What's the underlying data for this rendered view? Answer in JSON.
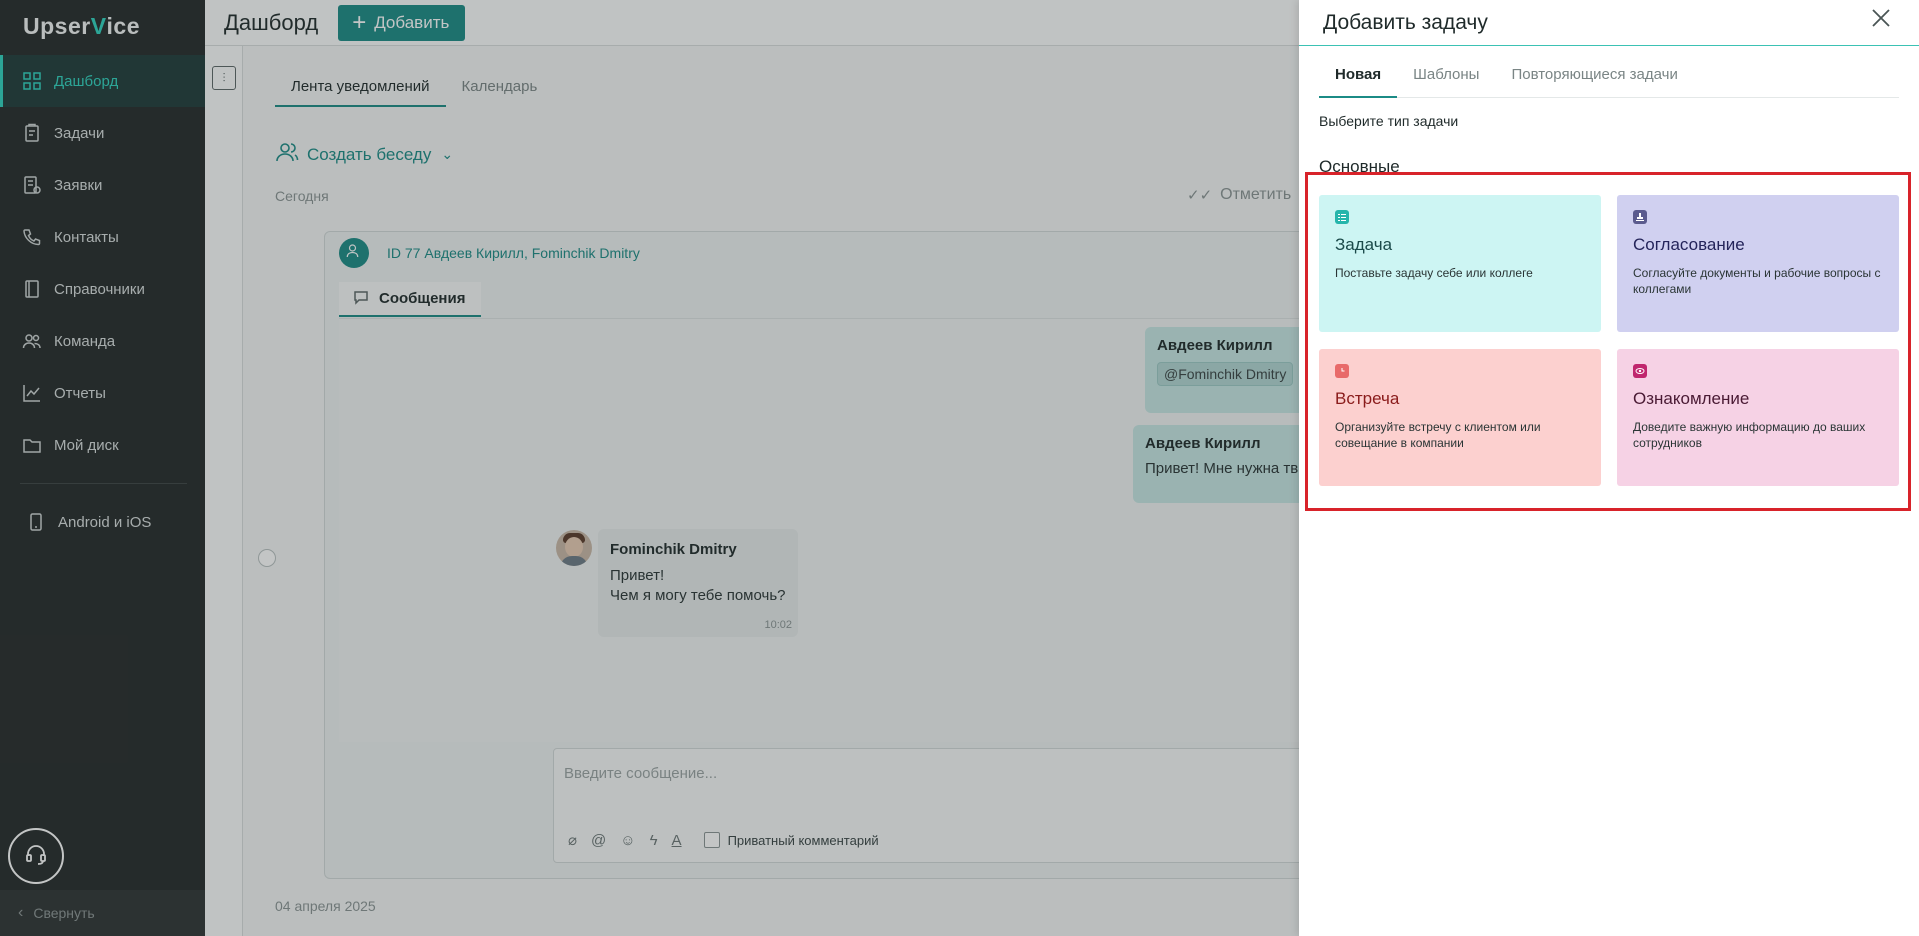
{
  "sidebar": {
    "logo": {
      "part1": "Upser",
      "part2": "V",
      "part3": "ice"
    },
    "items": [
      {
        "label": "Дашборд",
        "icon": "dashboard-icon",
        "active": true
      },
      {
        "label": "Задачи",
        "icon": "tasks-icon"
      },
      {
        "label": "Заявки",
        "icon": "requests-icon"
      },
      {
        "label": "Контакты",
        "icon": "phone-icon"
      },
      {
        "label": "Справочники",
        "icon": "book-icon"
      },
      {
        "label": "Команда",
        "icon": "team-icon"
      },
      {
        "label": "Отчеты",
        "icon": "chart-icon"
      },
      {
        "label": "Мой диск",
        "icon": "folder-icon"
      }
    ],
    "mobile": {
      "label": "Android и iOS",
      "icon": "phone-device-icon"
    },
    "collapse_label": "Свернуть"
  },
  "header": {
    "title": "Дашборд",
    "add_label": "Добавить"
  },
  "feed": {
    "tabs": [
      {
        "label": "Лента уведомлений",
        "active": true
      },
      {
        "label": "Календарь"
      }
    ],
    "create_chat_label": "Создать беседу",
    "today_label": "Сегодня",
    "mark_label": "Отметить",
    "chat": {
      "title": "ID 77 Авдеев Кирилл, Fominchik Dmitry",
      "messages_tab": "Сообщения",
      "out1": {
        "name": "Авдеев Кирилл",
        "mention": "@Fominchik Dmitry"
      },
      "out2": {
        "name": "Авдеев Кирилл",
        "text": "Привет! Мне нужна тв"
      },
      "in": {
        "name": "Fominchik Dmitry",
        "line1": "Привет!",
        "line2": "Чем я могу тебе помочь?",
        "time": "10:02"
      },
      "composer_placeholder": "Введите сообщение...",
      "private_label": "Приватный комментарий"
    },
    "date_separator": "04 апреля 2025"
  },
  "panel": {
    "title": "Добавить задачу",
    "tabs": [
      {
        "label": "Новая",
        "active": true
      },
      {
        "label": "Шаблоны"
      },
      {
        "label": "Повторяющиеся задачи"
      }
    ],
    "choose_label": "Выберите тип задачи",
    "section_label": "Основные",
    "cards": {
      "task": {
        "title": "Задача",
        "desc": "Поставьте задачу себе или коллеге",
        "color": "#cdf5f3"
      },
      "approval": {
        "title": "Согласование",
        "desc": "Согласуйте документы и рабочие вопросы с коллегами",
        "color": "#d0d0f0"
      },
      "meeting": {
        "title": "Встреча",
        "desc": "Организуйте встречу с клиентом или совещание в компании",
        "color": "#fcd0cf"
      },
      "ack": {
        "title": "Ознакомление",
        "desc": "Доведите важную информацию до ваших сотрудников",
        "color": "#f6d2e5"
      }
    }
  },
  "colors": {
    "accent": "#1b8b86",
    "highlight": "#d8232a"
  }
}
